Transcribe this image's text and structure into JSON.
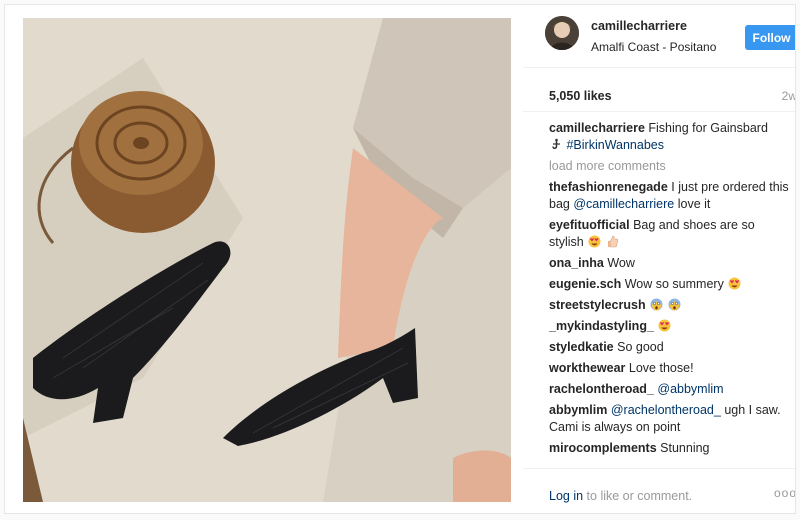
{
  "post": {
    "username": "camillecharriere",
    "location": "Amalfi Coast - Positano",
    "follow_label": "Follow",
    "likes": "5,050 likes",
    "time_ago": "2w",
    "caption": {
      "user": "camillecharriere",
      "text": "Fishing for Gainsbard",
      "hashtag": "#BirkinWannabes"
    },
    "load_more": "load more comments",
    "comments": [
      {
        "user": "thefashionrenegade",
        "text": "I just pre ordered this bag",
        "mention": "@camillecharriere",
        "after": "love it"
      },
      {
        "user": "eyefituofficial",
        "text": "Bag and shoes are so stylish"
      },
      {
        "user": "ona_inha",
        "text": "Wow"
      },
      {
        "user": "eugenie.sch",
        "text": "Wow so summery"
      },
      {
        "user": "streetstylecrush",
        "text": ""
      },
      {
        "user": "_mykindastyling_",
        "text": ""
      },
      {
        "user": "styledkatie",
        "text": "So good"
      },
      {
        "user": "workthewear",
        "text": "Love those!"
      },
      {
        "user": "rachelontheroad_",
        "mention": "@abbymlim"
      },
      {
        "user": "abbymlim",
        "mention": "@rachelontheroad_",
        "text": "ugh I saw. Cami is always on point"
      },
      {
        "user": "mirocomplements",
        "text": "Stunning"
      }
    ],
    "footer": {
      "login_link": "Log in",
      "login_rest": "to like or comment.",
      "more": "ooo"
    }
  },
  "colors": {
    "accent": "#3897f0",
    "link": "#003569",
    "muted": "#999999"
  },
  "icons": {
    "caption_emoji": "fishing-hook-icon",
    "heart_eyes": "heart-eyes-emoji",
    "thumbs_up": "thumbs-up-emoji",
    "scream": "scream-emoji"
  }
}
